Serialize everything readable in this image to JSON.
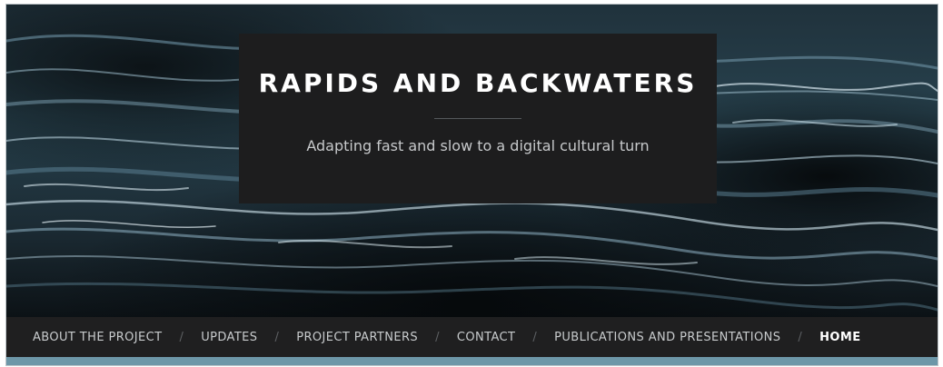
{
  "header": {
    "site_title": "RAPIDS AND BACKWATERS",
    "tagline": "Adapting fast and slow to a digital cultural turn",
    "background_image": "dark-water-waves"
  },
  "nav": {
    "items": [
      {
        "label": "ABOUT THE PROJECT",
        "active": false
      },
      {
        "label": "UPDATES",
        "active": false
      },
      {
        "label": "PROJECT PARTNERS",
        "active": false
      },
      {
        "label": "CONTACT",
        "active": false
      },
      {
        "label": "PUBLICATIONS AND PRESENTATIONS",
        "active": false
      },
      {
        "label": "HOME",
        "active": true
      }
    ],
    "separator": "/"
  },
  "colors": {
    "nav_background": "#1f1f20",
    "title_box": "#1d1d1e",
    "accent_bar": "#6d97a8",
    "water_highlight": "#8fb3c4"
  }
}
